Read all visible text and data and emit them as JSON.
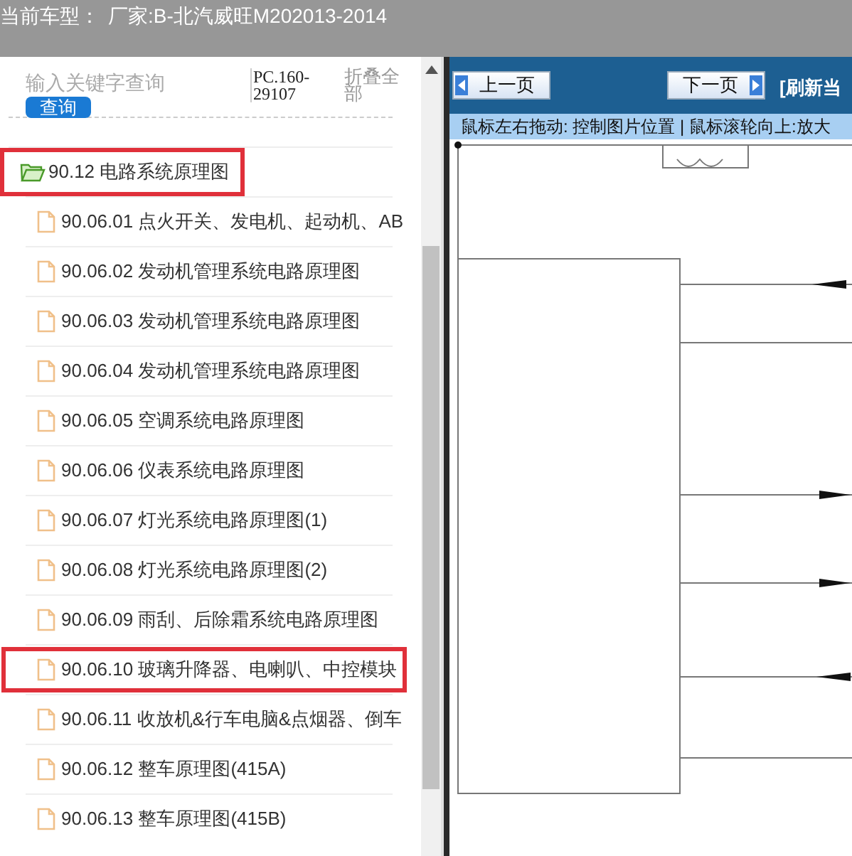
{
  "header": {
    "label": "当前车型：",
    "value": "厂家:B-北汽威旺M202013-2014"
  },
  "search": {
    "placeholder": "输入关键字查询",
    "button": "查询"
  },
  "code": "PC.160-29107",
  "collapse_all": "折叠全部",
  "tree": [
    {
      "label": "90.12 电路系统原理图",
      "expanded": true,
      "selected": true,
      "children": [
        {
          "label": "90.06.01 点火开关、发电机、起动机、AB",
          "selected": false
        },
        {
          "label": "90.06.02 发动机管理系统电路原理图",
          "selected": false
        },
        {
          "label": "90.06.03 发动机管理系统电路原理图",
          "selected": false
        },
        {
          "label": "90.06.04 发动机管理系统电路原理图",
          "selected": false
        },
        {
          "label": "90.06.05 空调系统电路原理图",
          "selected": false
        },
        {
          "label": "90.06.06 仪表系统电路原理图",
          "selected": false
        },
        {
          "label": "90.06.07 灯光系统电路原理图(1)",
          "selected": false
        },
        {
          "label": "90.06.08 灯光系统电路原理图(2)",
          "selected": false
        },
        {
          "label": "90.06.09 雨刮、后除霜系统电路原理图",
          "selected": false
        },
        {
          "label": "90.06.10 玻璃升降器、电喇叭、中控模块",
          "selected": true
        },
        {
          "label": "90.06.11 收放机&行车电脑&点烟器、倒车",
          "selected": false
        },
        {
          "label": "90.06.12 整车原理图(415A)",
          "selected": false
        },
        {
          "label": "90.06.13 整车原理图(415B)",
          "selected": false
        }
      ]
    }
  ],
  "viewer": {
    "prev": "上一页",
    "next": "下一页",
    "refresh": "[刷新当",
    "hint": "鼠标左右拖动: 控制图片位置 | 鼠标滚轮向上:放大"
  }
}
